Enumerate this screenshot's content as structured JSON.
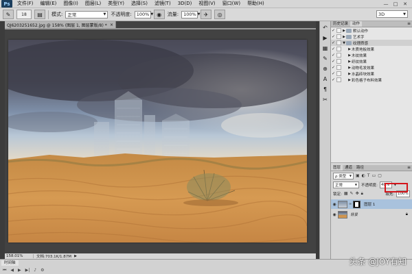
{
  "menubar": {
    "logo": "Ps",
    "items": [
      "文件(F)",
      "编辑(E)",
      "图像(I)",
      "图层(L)",
      "类型(Y)",
      "选择(S)",
      "滤镜(T)",
      "3D(D)",
      "视图(V)",
      "窗口(W)",
      "帮助(H)"
    ],
    "minimize": "—",
    "maximize": "□",
    "close": "✕"
  },
  "options": {
    "brush_size": "18",
    "mode_label": "模式:",
    "mode_value": "正常",
    "opacity_label": "不透明度:",
    "opacity_value": "100%",
    "flow_label": "流量:",
    "flow_value": "100%",
    "workspace": "3D"
  },
  "document": {
    "tab_title": "QJ6203251652.jpg @ 158% (图层 1, 图层蒙版/8) *",
    "zoom": "158.01%",
    "doc_info": "文档:703.1K/1.87M"
  },
  "actions_panel": {
    "tabs": [
      "历史记录",
      "动作"
    ],
    "rows": [
      {
        "label": "默认动作",
        "level": 0,
        "expanded": false
      },
      {
        "label": "艺术字",
        "level": 0,
        "expanded": false
      },
      {
        "label": "纹理质感",
        "level": 0,
        "expanded": true
      },
      {
        "label": "木质地板效果",
        "level": 1,
        "expanded": false
      },
      {
        "label": "木纹效果",
        "level": 1,
        "expanded": false
      },
      {
        "label": "织纹效果",
        "level": 1,
        "expanded": false
      },
      {
        "label": "动物毛发效果",
        "level": 1,
        "expanded": false
      },
      {
        "label": "水晶砖块效果",
        "level": 1,
        "expanded": false
      },
      {
        "label": "彩色格子布料效果",
        "level": 1,
        "expanded": false
      }
    ]
  },
  "layers_panel": {
    "tabs": [
      "图层",
      "通道",
      "路径"
    ],
    "kind_label": "ρ 类型",
    "blend_mode": "正常",
    "opacity_label": "不透明度:",
    "opacity_value": "40%",
    "lock_label": "锁定:",
    "fill_label": "填充:",
    "fill_value": "100%",
    "layers": [
      {
        "name": "图层 1",
        "selected": true,
        "has_mask": true
      },
      {
        "name": "背景",
        "selected": false,
        "has_mask": false,
        "locked": true
      }
    ]
  },
  "timeline": {
    "tab": "时间轴"
  },
  "watermark": "头条 @JOY有知"
}
